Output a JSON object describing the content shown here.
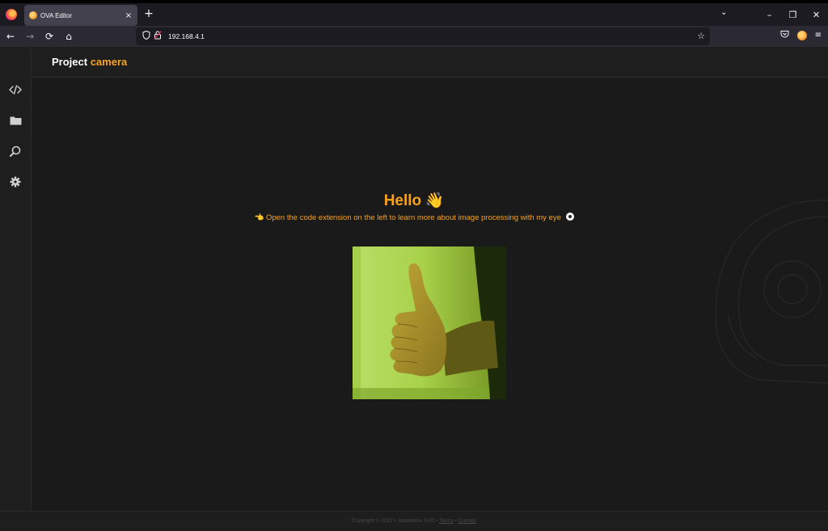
{
  "browser": {
    "tab_title": "OVA Editor",
    "tab_close": "×",
    "new_tab": "+",
    "tabs_list": "⌄",
    "window": {
      "minimize": "–",
      "restore": "❐",
      "close": "✕"
    },
    "nav": {
      "back": "←",
      "forward": "→",
      "reload": "⟳",
      "home": "⌂"
    },
    "url": "192.168.4.1",
    "bookmark_star": "☆",
    "menu": "≡"
  },
  "app": {
    "project_word": "Project",
    "project_name": "camera",
    "sidebar": [
      {
        "icon": "code-icon",
        "glyph": "</>"
      },
      {
        "icon": "folder-icon",
        "glyph": "▬"
      },
      {
        "icon": "extension-icon",
        "glyph": "⚲"
      },
      {
        "icon": "settings-icon",
        "glyph": "⚙"
      }
    ],
    "hello_title": "Hello",
    "hello_emoji": "👋",
    "hello_pointer": "👈",
    "hello_subtitle": "Open the code extension on the left to learn more about image processing with my eye",
    "footer": {
      "copyright": "Copyright © 2022 • Jusdeliens SAS •",
      "terms": "Terms",
      "sep": "•",
      "contact": "Contact"
    }
  },
  "colors": {
    "accent": "#f7a21b",
    "page_bg": "#1a1a1a"
  }
}
